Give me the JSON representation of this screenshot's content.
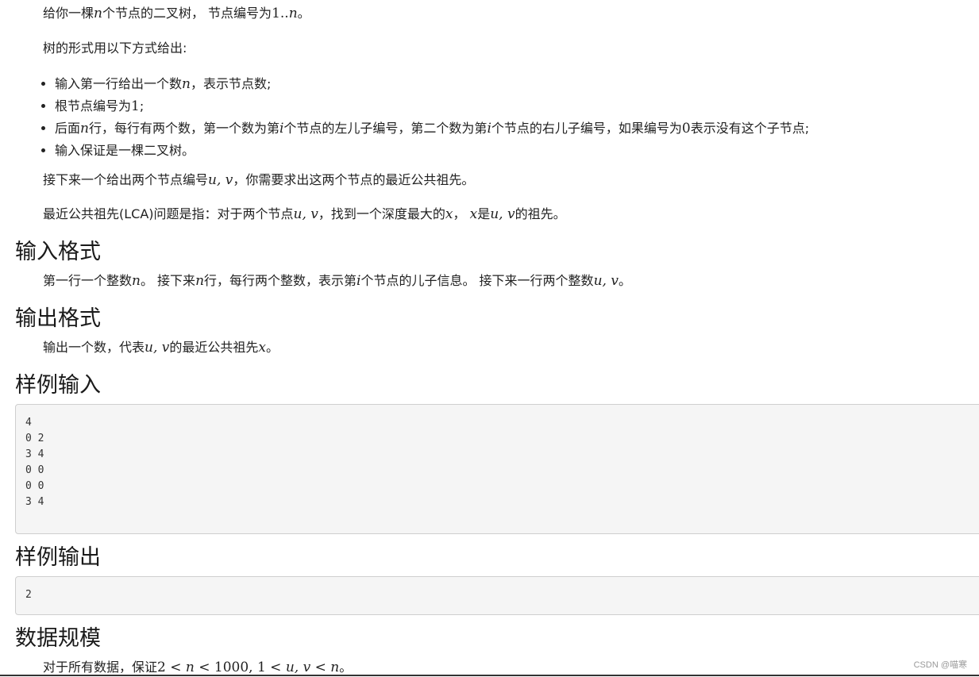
{
  "intro": {
    "p1": {
      "a": "给你一棵",
      "n": "n",
      "b": "个节点的二叉树， 节点编号为",
      "range": "1..",
      "n2": "n",
      "c": "。"
    },
    "p2": "树的形式用以下方式给出:",
    "bullets": [
      {
        "a": "输入第一行给出一个数",
        "n": "n",
        "b": "，表示节点数;"
      },
      {
        "a": "根节点编号为",
        "one": "1",
        "b": ";"
      },
      {
        "a": "后面",
        "n": "n",
        "b": "行，每行有两个数，第一个数为第",
        "i": "i",
        "c": "个节点的左儿子编号，第二个数为第",
        "i2": "i",
        "d": "个节点的右儿子编号，如果编号为",
        "zero": "0",
        "e": "表示没有这个子节点;"
      },
      {
        "a": "输入保证是一棵二叉树。"
      }
    ],
    "p3": {
      "a": "接下来一个给出两个节点编号",
      "uv": "u, v",
      "b": "，你需要求出这两个节点的最近公共祖先。"
    },
    "p4": {
      "a": "最近公共祖先(LCA)问题是指：对于两个节点",
      "uv": "u, v",
      "b": "，找到一个深度最大的",
      "x": "x",
      "c": "， ",
      "x2": "x",
      "d": "是",
      "uv2": "u, v",
      "e": "的祖先。"
    }
  },
  "input_format": {
    "title": "输入格式",
    "a": "第一行一个整数",
    "n": "n",
    "b": "。 接下来",
    "n2": "n",
    "c": "行，每行两个整数，表示第",
    "i": "i",
    "d": "个节点的儿子信息。 接下来一行两个整数",
    "uv": "u, v",
    "e": "。"
  },
  "output_format": {
    "title": "输出格式",
    "a": "输出一个数，代表",
    "uv": "u, v",
    "b": "的最近公共祖先",
    "x": "x",
    "c": "。"
  },
  "sample_input": {
    "title": "样例输入",
    "content": "4\n0 2\n3 4\n0 0\n0 0\n3 4"
  },
  "sample_output": {
    "title": "样例输出",
    "content": "2"
  },
  "data_scale": {
    "title": "数据规模",
    "a": "对于所有数据，保证",
    "formula_a": "2 < ",
    "n": "n",
    "formula_b": " < 1000, 1 < ",
    "uv": "u, v",
    "formula_c": " < ",
    "n2": "n",
    "b": "。"
  },
  "watermark": "CSDN @喵寒"
}
